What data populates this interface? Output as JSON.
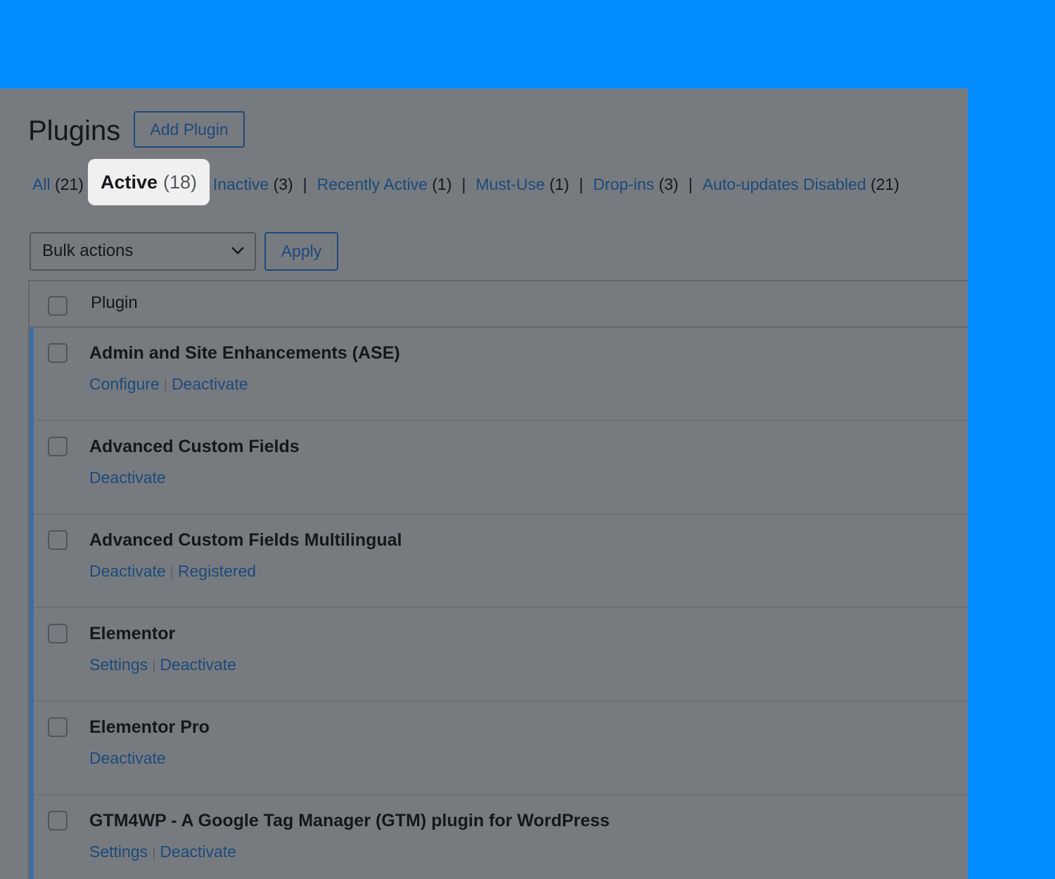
{
  "page": {
    "title": "Plugins",
    "add_button": "Add Plugin"
  },
  "filters": {
    "all": {
      "label": "All",
      "count": "(21)"
    },
    "active": {
      "label": "Active",
      "count": "(18)"
    },
    "inactive": {
      "label": "Inactive",
      "count": "(3)"
    },
    "recently_active": {
      "label": "Recently Active",
      "count": "(1)"
    },
    "must_use": {
      "label": "Must-Use",
      "count": "(1)"
    },
    "dropins": {
      "label": "Drop-ins",
      "count": "(3)"
    },
    "auto_updates_disabled": {
      "label": "Auto-updates Disabled",
      "count": "(21)"
    },
    "separator": "|"
  },
  "bulk": {
    "selected": "Bulk actions",
    "apply": "Apply"
  },
  "table": {
    "column_plugin": "Plugin",
    "rows": [
      {
        "name": "Admin and Site Enhancements (ASE)",
        "actions": [
          "Configure",
          "Deactivate"
        ]
      },
      {
        "name": "Advanced Custom Fields",
        "actions": [
          "Deactivate"
        ]
      },
      {
        "name": "Advanced Custom Fields Multilingual",
        "actions": [
          "Deactivate",
          "Registered"
        ]
      },
      {
        "name": "Elementor",
        "actions": [
          "Settings",
          "Deactivate"
        ]
      },
      {
        "name": "Elementor Pro",
        "actions": [
          "Deactivate"
        ]
      },
      {
        "name": "GTM4WP - A Google Tag Manager (GTM) plugin for WordPress",
        "actions": [
          "Settings",
          "Deactivate"
        ]
      }
    ],
    "action_separator": "|"
  },
  "icons": {
    "bulk_dropdown": "chevron-down-icon"
  },
  "colors": {
    "background": "#028cff",
    "overlay": "#777b80",
    "link": "#1d4a7a",
    "active_row_border": "#3c6ea3",
    "highlight": "#f0f0f1"
  }
}
